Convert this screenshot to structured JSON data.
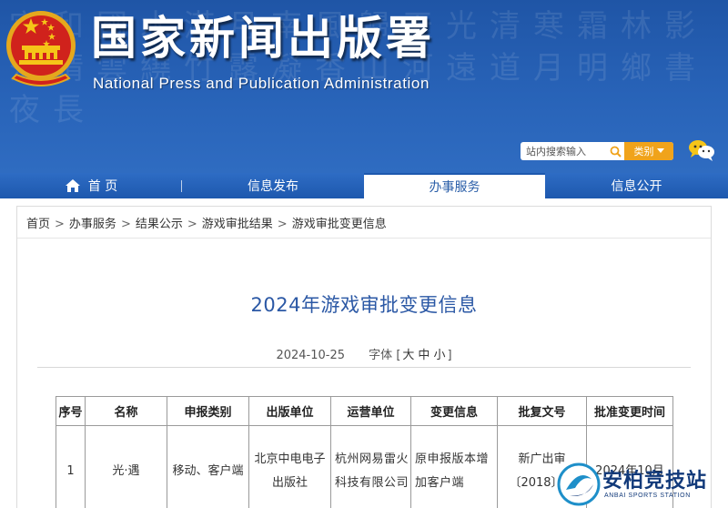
{
  "header": {
    "title": "国家新闻出版署",
    "subtitle": "National  Press and Publication Administration",
    "search": {
      "placeholder": "站内搜索输入",
      "category_label": "类别"
    },
    "background_text": "宇和國水滿月南風歸天光清寒霜林影落晴雲繞竹露凝香山河遠道月明鄉書夜長"
  },
  "nav": {
    "items": [
      {
        "label": "首 页"
      },
      {
        "label": "信息发布"
      },
      {
        "label": "办事服务"
      },
      {
        "label": "信息公开"
      }
    ],
    "active_index": 2
  },
  "breadcrumb": [
    "首页",
    "办事服务",
    "结果公示",
    "游戏审批结果",
    "游戏审批变更信息"
  ],
  "article": {
    "title": "2024年游戏审批变更信息",
    "date": "2024-10-25",
    "font_label": "字体",
    "font_sizes": [
      "大",
      "中",
      "小"
    ]
  },
  "table": {
    "headers": [
      "序号",
      "名称",
      "申报类别",
      "出版单位",
      "运营单位",
      "变更信息",
      "批复文号",
      "批准变更时间"
    ],
    "rows": [
      {
        "no": "1",
        "name": "光·遇",
        "category": "移动、客户端",
        "publisher": "北京中电电子出版社",
        "operator": "杭州网易雷火科技有限公司",
        "change": "原申报版本增加客户端",
        "approval": "新广出审〔2018〕号",
        "time": "2024年10月"
      }
    ]
  },
  "watermark": {
    "text": "安柏竞技站",
    "sub": "ANBAI SPORTS STATION"
  },
  "colors": {
    "banner": "#2863b8",
    "nav": "#1d58ae",
    "title_blue": "#2b58a5",
    "accent_orange": "#f0a31b"
  }
}
